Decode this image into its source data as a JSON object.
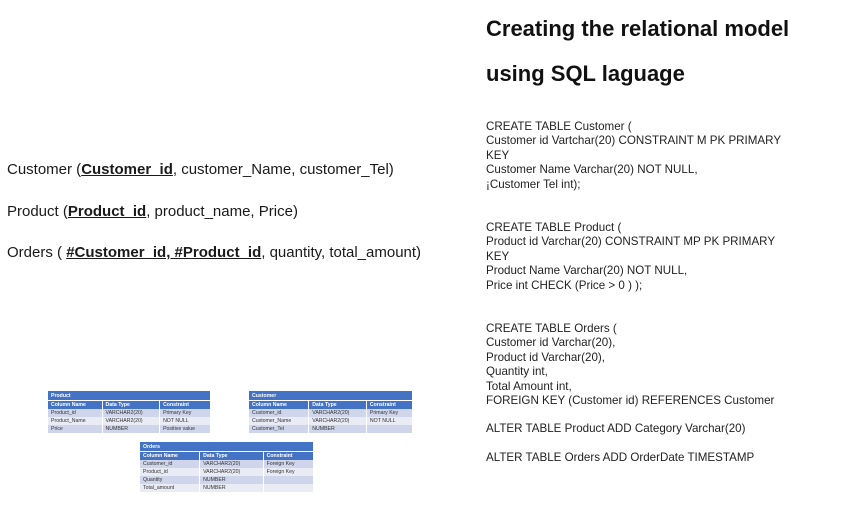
{
  "relations": {
    "customer": {
      "name": "Customer (",
      "key": "Customer_id",
      "rest": ", customer_Name, customer_Tel)"
    },
    "product": {
      "name": "Product (",
      "key": "Product_id",
      "rest": ", product_name, Price)"
    },
    "orders": {
      "name": "Orders ( ",
      "key": "#Customer_id, #Product_id",
      "rest": ", quantity, total_amount)"
    }
  },
  "title": {
    "line1": "Creating the relational model",
    "line2": "using SQL laguage"
  },
  "sql": {
    "customer": "CREATE TABLE Customer (\nCustomer id Vartchar(20) CONSTRAINT M PK PRIMARY\nKEY\nCustomer Name Varchar(20) NOT NULL,\n¡Customer Tel int);",
    "product": "CREATE TABLE Product (\nProduct id Varchar(20) CONSTRAINT MP PK PRIMARY\nKEY\nProduct Name Varchar(20) NOT NULL,\nPrice int CHECK (Price > 0 ) );",
    "orders": "CREATE TABLE Orders (\nCustomer id Varchar(20),\nProduct id Varchar(20),\nQuantity int,\nTotal Amount int,\nFOREIGN KEY (Customer id) REFERENCES Customer",
    "alter1": "ALTER TABLE Product ADD Category Varchar(20)",
    "alter2": "ALTER TABLE Orders ADD OrderDate TIMESTAMP"
  },
  "tables": {
    "product": {
      "title": "Product",
      "headers": [
        "Column Name",
        "Data Type",
        "Constraint"
      ],
      "rows": [
        [
          "Product_id",
          "VARCHAR2(20)",
          "Primary Key"
        ],
        [
          "Product_Name",
          "VARCHAR2(20)",
          "NOT NULL"
        ],
        [
          "Price",
          "NUMBER",
          "Positive value"
        ]
      ]
    },
    "customer": {
      "title": "Customer",
      "headers": [
        "Column Name",
        "Data Type",
        "Constraint"
      ],
      "rows": [
        [
          "Customer_id",
          "VARCHAR2(20)",
          "Primary Key"
        ],
        [
          "Customer_Name",
          "VARCHAR2(20)",
          "NOT NULL"
        ],
        [
          "Customer_Tel",
          "NUMBER",
          ""
        ]
      ]
    },
    "orders": {
      "title": "Orders",
      "headers": [
        "Column Name",
        "Data Type",
        "Constraint"
      ],
      "rows": [
        [
          "Customer_id",
          "VARCHAR2(20)",
          "Foreign Key"
        ],
        [
          "Product_id",
          "VARCHAR2(20)",
          "Foreign Key"
        ],
        [
          "Quantity",
          "NUMBER",
          ""
        ],
        [
          "Total_amount",
          "NUMBER",
          ""
        ]
      ]
    }
  }
}
